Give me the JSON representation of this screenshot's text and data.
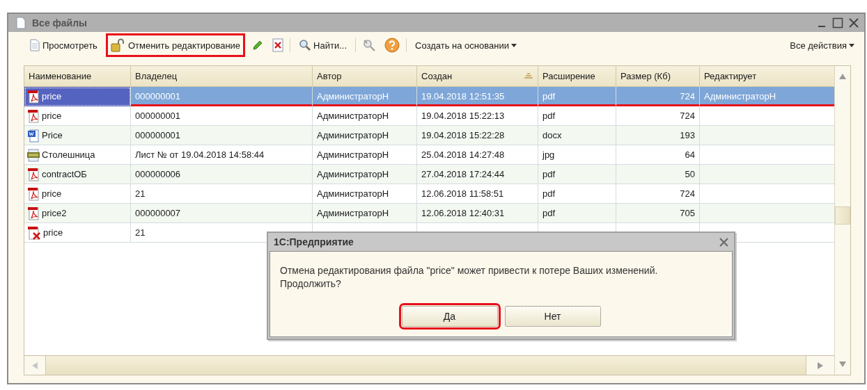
{
  "window": {
    "title": "Все файлы"
  },
  "toolbar": {
    "items": [
      {
        "kind": "view",
        "label": "Просмотреть"
      },
      {
        "kind": "unlock",
        "label": "Отменить редактирование",
        "highlighted": true
      },
      {
        "kind": "edit"
      },
      {
        "kind": "delete"
      },
      {
        "kind": "separator"
      },
      {
        "kind": "find",
        "label": "Найти..."
      },
      {
        "kind": "separator"
      },
      {
        "kind": "find-cancel"
      },
      {
        "kind": "help"
      },
      {
        "kind": "separator"
      },
      {
        "kind": "menu",
        "label": "Создать на основании"
      }
    ],
    "right": {
      "kind": "menu",
      "label": "Все действия"
    }
  },
  "table": {
    "columns": [
      {
        "label": "Наименование",
        "sorted": false
      },
      {
        "label": "Владелец",
        "sorted": false
      },
      {
        "label": "Автор",
        "sorted": false
      },
      {
        "label": "Создан",
        "sorted": true
      },
      {
        "label": "Расширение",
        "sorted": false
      },
      {
        "label": "Размер (Кб)",
        "sorted": false
      },
      {
        "label": "Редактирует",
        "sorted": false
      }
    ],
    "rows": [
      {
        "kind": "pdf",
        "selected": true,
        "underlined": true,
        "cells": [
          "price",
          "000000001",
          "АдминистраторН",
          "19.04.2018 12:51:35",
          "pdf",
          "724",
          "АдминистраторН"
        ]
      },
      {
        "kind": "pdf",
        "selected": false,
        "underlined": false,
        "cells": [
          "price",
          "000000001",
          "АдминистраторН",
          "19.04.2018 15:22:13",
          "pdf",
          "724"
        ]
      },
      {
        "kind": "docx",
        "selected": false,
        "underlined": false,
        "cells": [
          "Price",
          "000000001",
          "АдминистраторН",
          "19.04.2018 15:22:28",
          "docx",
          "193"
        ]
      },
      {
        "kind": "jpg",
        "selected": false,
        "underlined": false,
        "cells": [
          "Столешница",
          "Лист №  от 19.04.2018 14:58:44",
          "АдминистраторН",
          "25.04.2018 14:27:48",
          "jpg",
          "64"
        ]
      },
      {
        "kind": "pdf",
        "selected": false,
        "underlined": false,
        "cells": [
          "contractОБ",
          "000000006",
          "АдминистраторН",
          "27.04.2018 17:24:44",
          "pdf",
          "50"
        ]
      },
      {
        "kind": "pdf",
        "selected": false,
        "underlined": false,
        "cells": [
          "price",
          "21",
          "АдминистраторН",
          "12.06.2018 11:58:51",
          "pdf",
          "724"
        ]
      },
      {
        "kind": "pdf",
        "selected": false,
        "underlined": false,
        "cells": [
          "price2",
          "000000007",
          "АдминистраторН",
          "12.06.2018 12:40:31",
          "pdf",
          "705"
        ]
      },
      {
        "kind": "deleted",
        "selected": false,
        "underlined": false,
        "cells": [
          "price",
          "21"
        ]
      }
    ]
  },
  "dialog": {
    "title": "1С:Предприятие",
    "message": "Отмена редактирования файла \"price\" может привести к потере Ваших изменений. Продолжить?",
    "buttons": [
      {
        "label": "Да",
        "highlighted": true,
        "focused": false
      },
      {
        "label": "Нет",
        "highlighted": false,
        "focused": true
      }
    ]
  }
}
